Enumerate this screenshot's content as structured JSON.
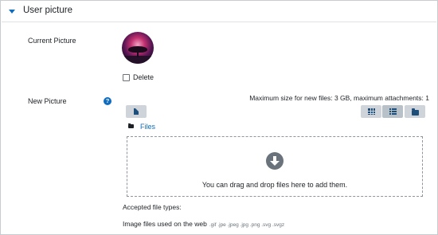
{
  "section": {
    "title": "User picture",
    "colors": {
      "accent": "#0f6cbf",
      "button_bg": "#ced4da"
    }
  },
  "current_picture": {
    "label": "Current Picture",
    "delete_label": "Delete",
    "delete_checked": false
  },
  "new_picture": {
    "label": "New Picture",
    "max_size_text": "Maximum size for new files: 3 GB, maximum attachments: 1",
    "files_link": "Files",
    "drop_text": "You can drag and drop files here to add them.",
    "accepted_label": "Accepted file types:",
    "accepted_types_label": "Image files used on the web",
    "accepted_types_ext": ".gif .jpe .jpeg .jpg .png .svg .svgz",
    "view_modes": [
      "grid-icon",
      "list-icon",
      "folder-icon"
    ],
    "active_view_mode": "list-icon"
  }
}
